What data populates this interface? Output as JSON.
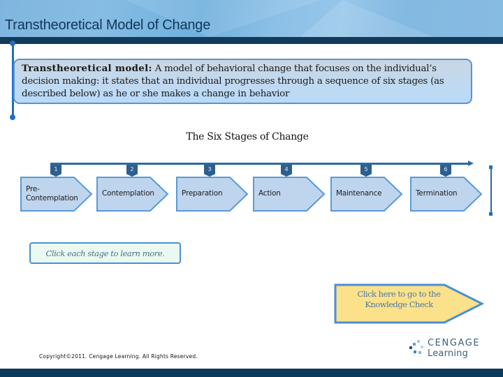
{
  "header": {
    "title": "Transtheoretical Model of Change"
  },
  "definition": {
    "term": "Transtheoretical model:",
    "text": " A model of behavioral change that focuses on the individual’s decision making: it states that an individual progresses through a sequence of six stages (as described below) as he or she makes a change in behavior"
  },
  "stages_section": {
    "title": "The Six Stages of Change",
    "stages": [
      {
        "number": "1",
        "label": "Pre-\nContemplation"
      },
      {
        "number": "2",
        "label": "Contemplation"
      },
      {
        "number": "3",
        "label": "Preparation"
      },
      {
        "number": "4",
        "label": "Action"
      },
      {
        "number": "5",
        "label": "Maintenance"
      },
      {
        "number": "6",
        "label": "Termination"
      }
    ]
  },
  "hint": {
    "text": "Click each stage to learn more."
  },
  "knowledge_check": {
    "label": "Click here to go to the Knowledge Check"
  },
  "footer": {
    "copyright": "Copyright©2011. Cengage Learning. All Rights Reserved.",
    "logo_line1": "CENGAGE",
    "logo_line2": "Learning"
  },
  "colors": {
    "stage_fill": "#bfd5ee",
    "stage_border": "#5a9ad6",
    "badge": "#2c5f8f",
    "knowledge_check_fill": "#fbe18a",
    "dark_bar": "#123a5a"
  }
}
